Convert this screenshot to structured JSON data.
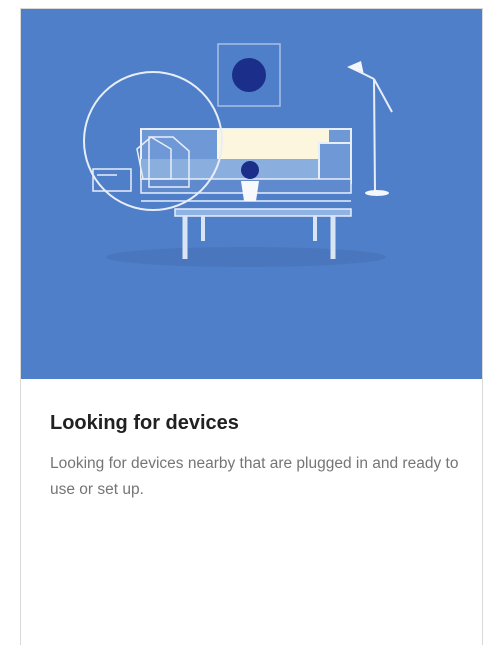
{
  "screen": {
    "title": "Looking for devices",
    "description": "Looking for devices nearby that are plugged in and ready to use or set up."
  },
  "illustration": {
    "icon": "living-room-illustration",
    "colors": {
      "background": "#4f7fc8",
      "line": "#e8eef8",
      "cushion": "#fdf6df",
      "accent": "#1b2f8a"
    }
  }
}
